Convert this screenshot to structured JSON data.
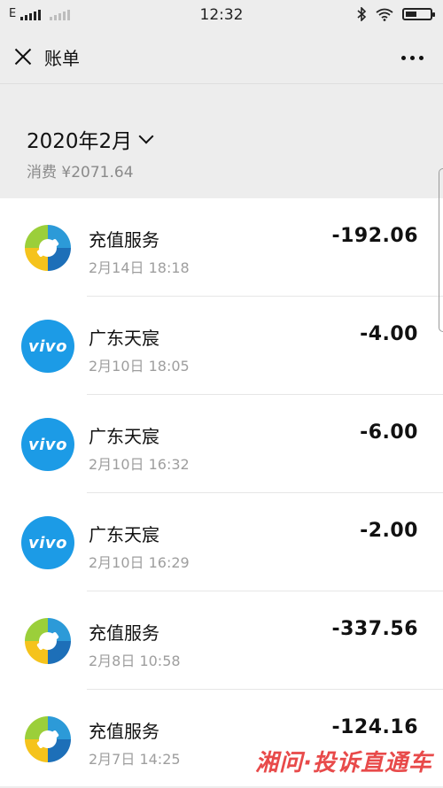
{
  "status_bar": {
    "network": "E",
    "time": "12:32",
    "icons": [
      "bluetooth-icon",
      "wifi-icon",
      "battery-icon"
    ]
  },
  "nav": {
    "title": "账单",
    "close_icon": "close-icon",
    "more_icon": "more-icon"
  },
  "summary": {
    "month": "2020年2月",
    "spend": "消费 ¥2071.64"
  },
  "transactions": [
    {
      "icon": "recharge-icon",
      "name": "充值服务",
      "time": "2月14日 18:18",
      "amount": "-192.06"
    },
    {
      "icon": "vivo-icon",
      "name": "广东天宸",
      "time": "2月10日 18:05",
      "amount": "-4.00"
    },
    {
      "icon": "vivo-icon",
      "name": "广东天宸",
      "time": "2月10日 16:32",
      "amount": "-6.00"
    },
    {
      "icon": "vivo-icon",
      "name": "广东天宸",
      "time": "2月10日 16:29",
      "amount": "-2.00"
    },
    {
      "icon": "recharge-icon",
      "name": "充值服务",
      "time": "2月8日 10:58",
      "amount": "-337.56"
    },
    {
      "icon": "recharge-icon",
      "name": "充值服务",
      "time": "2月7日 14:25",
      "amount": "-124.16"
    }
  ],
  "vivo_logo_text": "vivo",
  "watermark": "湘问·投诉直通车",
  "colors": {
    "vivo_blue": "#1c9be6",
    "watermark_red": "#e84a4a"
  }
}
